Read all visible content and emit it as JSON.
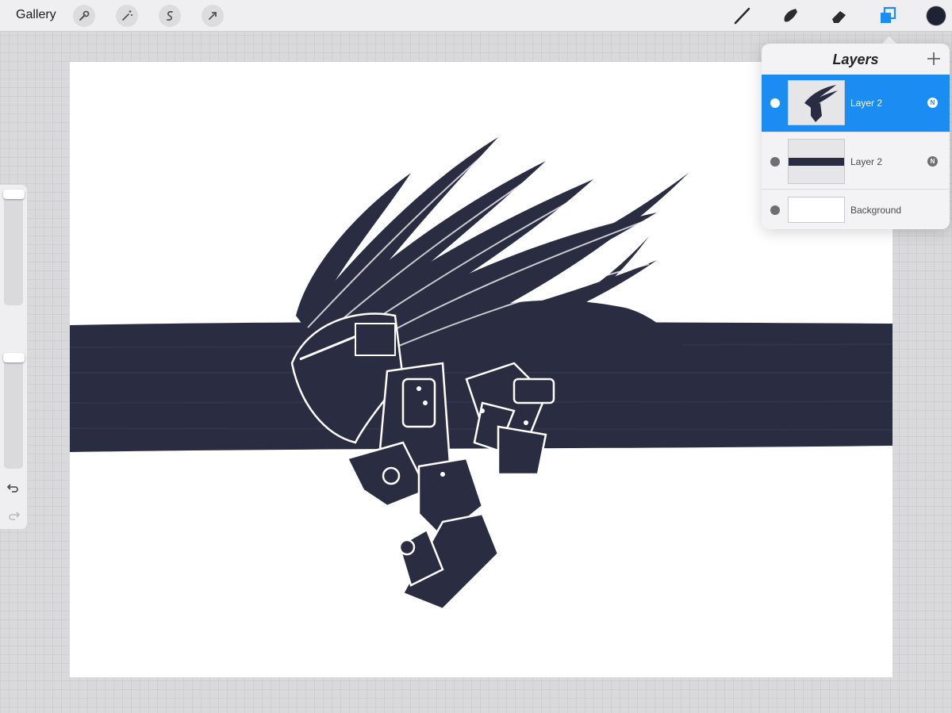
{
  "toolbar": {
    "gallery_label": "Gallery",
    "left_tools": [
      "wrench-icon",
      "magic-wand-icon",
      "selection-icon",
      "transform-arrow-icon"
    ],
    "right_tools": [
      "brush-icon",
      "smudge-icon",
      "eraser-icon",
      "layers-icon"
    ],
    "active_tool": "layers-icon",
    "current_color": "#1e2233"
  },
  "sidebar": {
    "brush_size_level": 0.0,
    "opacity_level": 0.0,
    "undo_icon": "undo-icon",
    "redo_icon": "redo-icon"
  },
  "layers_panel": {
    "title": "Layers",
    "add_icon": "plus-icon",
    "layers": [
      {
        "name": "Layer 2",
        "blend": "N",
        "visible": true,
        "selected": true
      },
      {
        "name": "Layer 2",
        "blend": "N",
        "visible": true,
        "selected": false
      },
      {
        "name": "Background",
        "visible": true,
        "selected": false
      }
    ]
  },
  "colors": {
    "accent": "#1a8cf2",
    "ink": "#2a2d42",
    "canvas": "#ffffff",
    "workspace": "#d9d9db"
  }
}
